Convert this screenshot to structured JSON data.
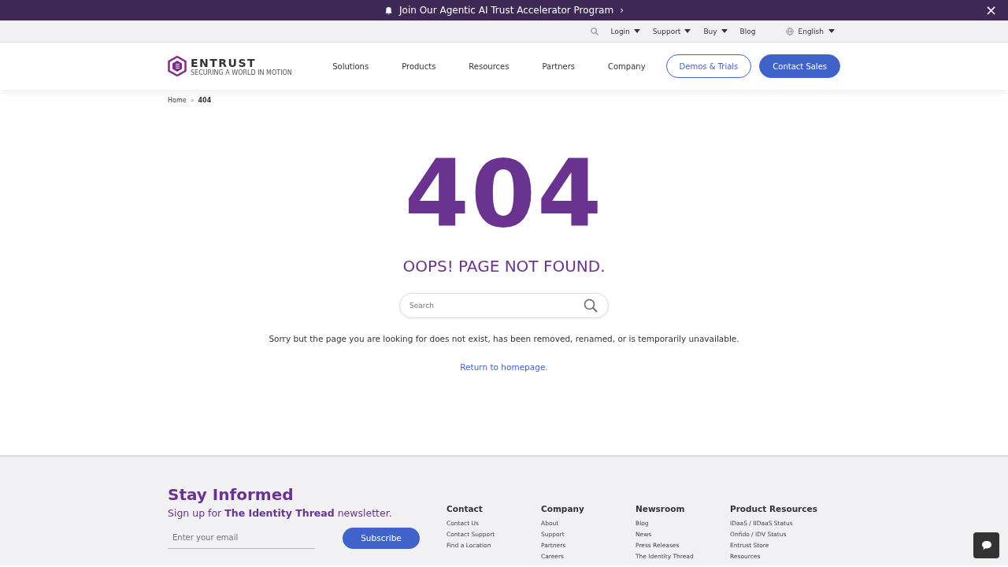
{
  "announcement": {
    "text": "Join Our Agentic AI Trust Accelerator Program",
    "arrow": "›",
    "close": "×"
  },
  "utility_nav": {
    "items": [
      {
        "label": "Login",
        "dropdown": true
      },
      {
        "label": "Support",
        "dropdown": true
      },
      {
        "label": "Buy",
        "dropdown": true
      },
      {
        "label": "Blog",
        "dropdown": false
      }
    ],
    "language": "English"
  },
  "header": {
    "logo": {
      "name": "ENTRUST",
      "tagline": "SECURING A WORLD IN MOTION"
    },
    "nav": [
      "Solutions",
      "Products",
      "Resources",
      "Partners",
      "Company"
    ],
    "buttons": [
      {
        "label": "Demos & Trials",
        "kind": "outline"
      },
      {
        "label": "Contact Sales",
        "kind": "filled"
      }
    ]
  },
  "breadcrumb": [
    "Home",
    "»",
    "404"
  ],
  "error": {
    "code": "404",
    "title": "OOPS! PAGE NOT FOUND.",
    "search_placeholder": "Search",
    "message": "Sorry but the page you are looking for does not exist, has been removed, renamed, or is temporarily unavailable.",
    "link": "Return to homepage."
  },
  "footer": {
    "title": "Stay Informed",
    "subtitle": "Sign up for **The Identity Thread** newsletter.",
    "email_placeholder": "Enter your email",
    "subscribe": "Subscribe",
    "columns": [
      {
        "heading": "Contact",
        "links": [
          "Contact Us",
          "Contact Support",
          "Find a Location"
        ]
      },
      {
        "heading": "Company",
        "links": [
          "About",
          "Support",
          "Partners",
          "Careers"
        ]
      },
      {
        "heading": "Newsroom",
        "links": [
          "Blog",
          "News",
          "Press Releases",
          "The Identity Thread"
        ]
      },
      {
        "heading": "Product Resources",
        "links": [
          "IDaaS / IIDaaS Status",
          "Onfido / IDV Status",
          "Entrust Store",
          "Resources"
        ]
      }
    ]
  }
}
